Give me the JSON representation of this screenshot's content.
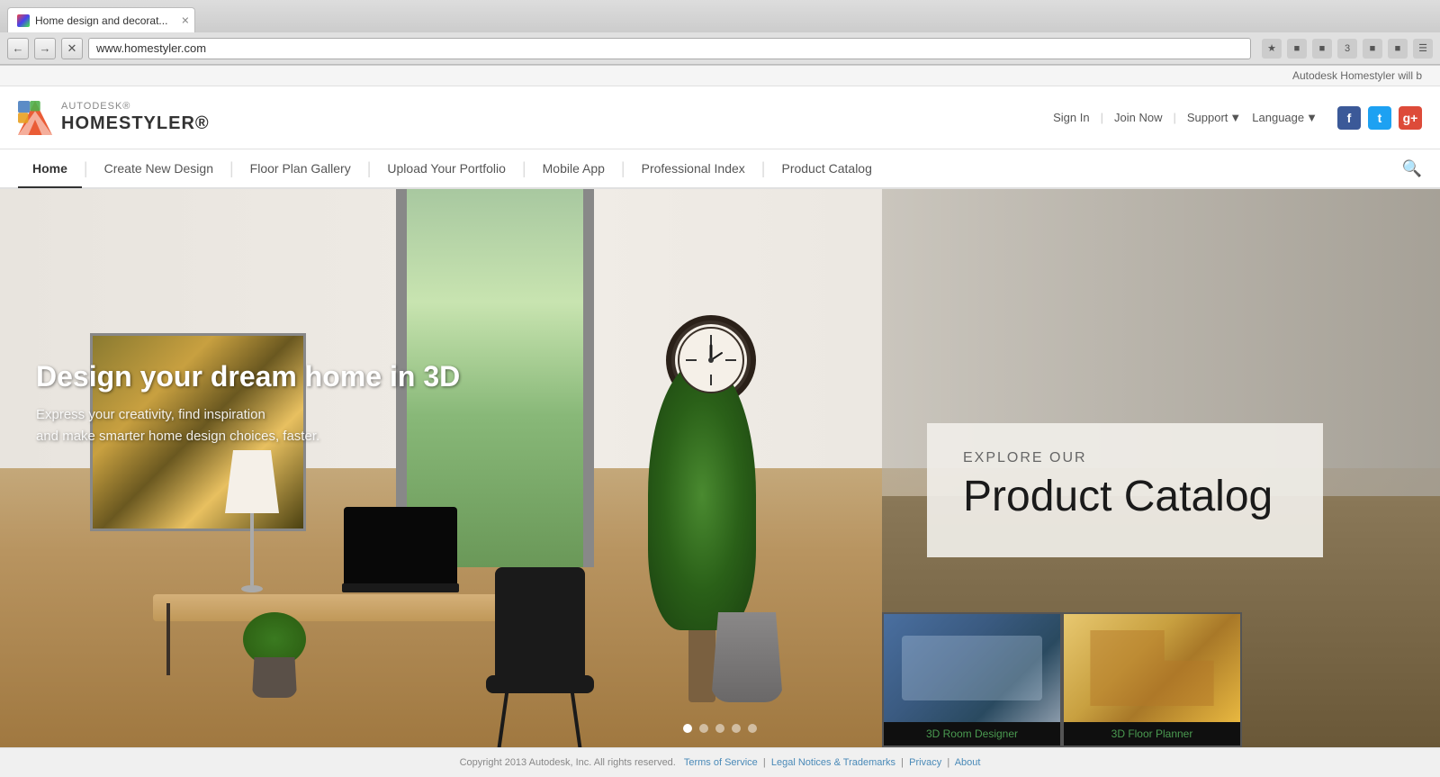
{
  "browser": {
    "tab_title": "Home design and decorat...",
    "url": "www.homestyler.com",
    "loading": false
  },
  "notification": {
    "text": "Autodesk Homestyler will b"
  },
  "header": {
    "autodesk_label": "AUTODESK®",
    "brand_label": "HOMESTYLER®",
    "sign_in": "Sign In",
    "join_now": "Join Now",
    "support": "Support",
    "language": "Language"
  },
  "nav": {
    "items": [
      {
        "id": "home",
        "label": "Home",
        "active": true
      },
      {
        "id": "create",
        "label": "Create New Design",
        "active": false
      },
      {
        "id": "floorplan",
        "label": "Floor Plan Gallery",
        "active": false
      },
      {
        "id": "upload",
        "label": "Upload Your Portfolio",
        "active": false
      },
      {
        "id": "mobile",
        "label": "Mobile App",
        "active": false
      },
      {
        "id": "professional",
        "label": "Professional Index",
        "active": false
      },
      {
        "id": "catalog",
        "label": "Product Catalog",
        "active": false
      }
    ]
  },
  "hero": {
    "headline": "Design your dream home in 3D",
    "subtext_line1": "Express your creativity, find inspiration",
    "subtext_line2": "and make smarter home design choices, faster.",
    "explore_subtitle": "EXPLORE OUR",
    "explore_title": "Product Catalog",
    "dots": [
      {
        "active": true
      },
      {
        "active": false
      },
      {
        "active": false
      },
      {
        "active": false
      },
      {
        "active": false
      }
    ]
  },
  "thumbnails": [
    {
      "id": "room-designer",
      "label": "3D Room Designer",
      "type": "room"
    },
    {
      "id": "floor-planner",
      "label": "3D Floor Planner",
      "type": "floor"
    }
  ],
  "footer": {
    "copyright": "Copyright 2013 Autodesk, Inc. All rights reserved.",
    "terms": "Terms of Service",
    "legal": "Legal Notices & Trademarks",
    "privacy": "Privacy",
    "about": "About"
  },
  "social": {
    "facebook": "f",
    "twitter": "t",
    "gplus": "g+"
  }
}
